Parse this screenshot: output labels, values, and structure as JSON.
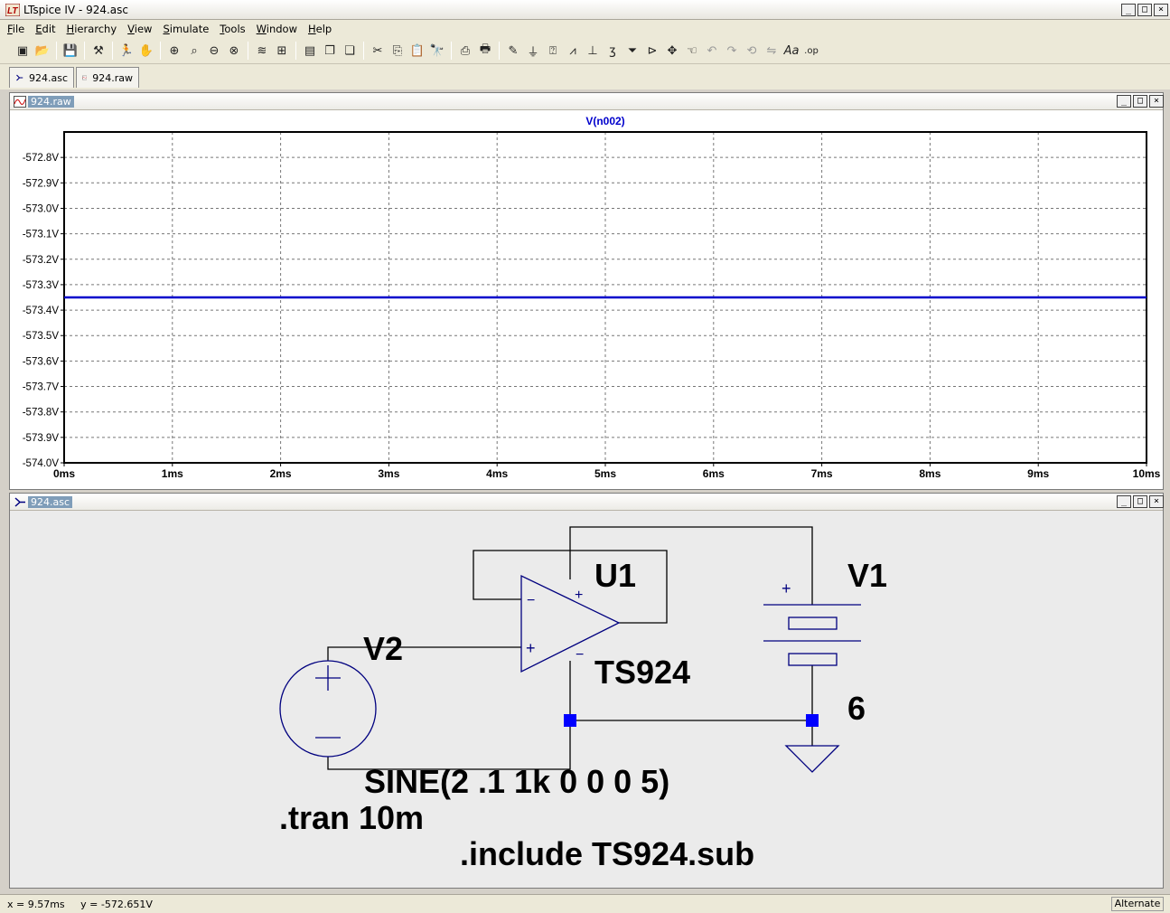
{
  "app": {
    "title": "LTspice IV - 924.asc",
    "logo": "LT"
  },
  "menus": [
    {
      "label": "File",
      "u": "F",
      "rest": "ile"
    },
    {
      "label": "Edit",
      "u": "E",
      "rest": "dit"
    },
    {
      "label": "Hierarchy",
      "u": "H",
      "rest": "ierarchy"
    },
    {
      "label": "View",
      "u": "V",
      "rest": "iew"
    },
    {
      "label": "Simulate",
      "u": "S",
      "rest": "imulate"
    },
    {
      "label": "Tools",
      "u": "T",
      "rest": "ools"
    },
    {
      "label": "Window",
      "u": "W",
      "rest": "indow"
    },
    {
      "label": "Help",
      "u": "H",
      "rest": "elp"
    }
  ],
  "tabs": [
    {
      "label": "924.asc",
      "icon": "schematic-icon"
    },
    {
      "label": "924.raw",
      "icon": "waveform-icon"
    }
  ],
  "plot_window": {
    "title": "924.raw"
  },
  "chart_data": {
    "type": "line",
    "series": [
      {
        "name": "V(n002)",
        "color": "#0000cc",
        "x": [
          0,
          10
        ],
        "y": [
          -573.35,
          -573.35
        ]
      }
    ],
    "xlim": [
      0,
      10
    ],
    "ylim": [
      -574.0,
      -572.7
    ],
    "x_ticks": [
      0,
      1,
      2,
      3,
      4,
      5,
      6,
      7,
      8,
      9,
      10
    ],
    "x_tick_labels": [
      "0ms",
      "1ms",
      "2ms",
      "3ms",
      "4ms",
      "5ms",
      "6ms",
      "7ms",
      "8ms",
      "9ms",
      "10ms"
    ],
    "y_ticks": [
      -572.8,
      -572.9,
      -573.0,
      -573.1,
      -573.2,
      -573.3,
      -573.4,
      -573.5,
      -573.6,
      -573.7,
      -573.8,
      -573.9,
      -574.0
    ],
    "y_tick_labels": [
      "-572.8V",
      "-572.9V",
      "-573.0V",
      "-573.1V",
      "-573.2V",
      "-573.3V",
      "-573.4V",
      "-573.5V",
      "-573.6V",
      "-573.7V",
      "-573.8V",
      "-573.9V",
      "-574.0V"
    ],
    "grid": true,
    "trace_label": "V(n002)"
  },
  "schematic_window": {
    "title": "924.asc"
  },
  "schematic": {
    "u1_name": "U1",
    "u1_model": "TS924",
    "v1_name": "V1",
    "v1_value": "6",
    "v2_name": "V2",
    "v2_value": "SINE(2 .1 1k 0 0 0 5)",
    "directive_tran": ".tran 10m",
    "directive_include": ".include TS924.sub",
    "plus": "+",
    "minus": "−",
    "wire_color": "#000000",
    "symbol_color": "#00007f",
    "node_color": "#0000ff"
  },
  "status": {
    "coords": "x = 9.57ms     y = -572.651V",
    "mode": "Alternate"
  },
  "winbtn": {
    "min": "_",
    "max": "□",
    "close": "×"
  }
}
